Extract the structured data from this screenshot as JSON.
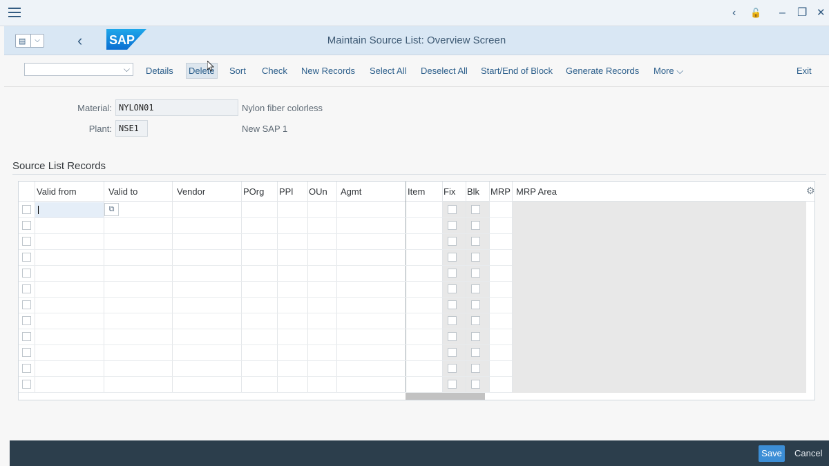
{
  "shell": {
    "title": "Maintain Source List: Overview Screen",
    "logo_text": "SAP"
  },
  "window_controls": {
    "back_icon": "‹",
    "lock_icon": "🔓",
    "minimize_icon": "‒",
    "restore_icon": "❐",
    "close_icon": "✕"
  },
  "toolbar": {
    "items": [
      "Details",
      "Delete",
      "Sort",
      "Check",
      "New Records",
      "Select All",
      "Deselect All",
      "Start/End of Block",
      "Generate Records",
      "More"
    ],
    "exit": "Exit"
  },
  "form": {
    "material_label": "Material:",
    "material_value": "NYLON01",
    "material_desc": "Nylon fiber colorless",
    "plant_label": "Plant:",
    "plant_value": "NSE1",
    "plant_desc": "New SAP 1"
  },
  "section": {
    "title": "Source List Records"
  },
  "table": {
    "columns": [
      "Valid from",
      "Valid to",
      "Vendor",
      "POrg",
      "PPl",
      "OUn",
      "Agmt",
      "Item",
      "Fix",
      "Blk",
      "MRP",
      "MRP Area"
    ],
    "row_count": 12
  },
  "footer": {
    "save": "Save",
    "cancel": "Cancel"
  },
  "colors": {
    "accent": "#3c8ed6",
    "shell": "#d9e7f4",
    "footer": "#2c3e4c",
    "link": "#2a5d8a"
  }
}
